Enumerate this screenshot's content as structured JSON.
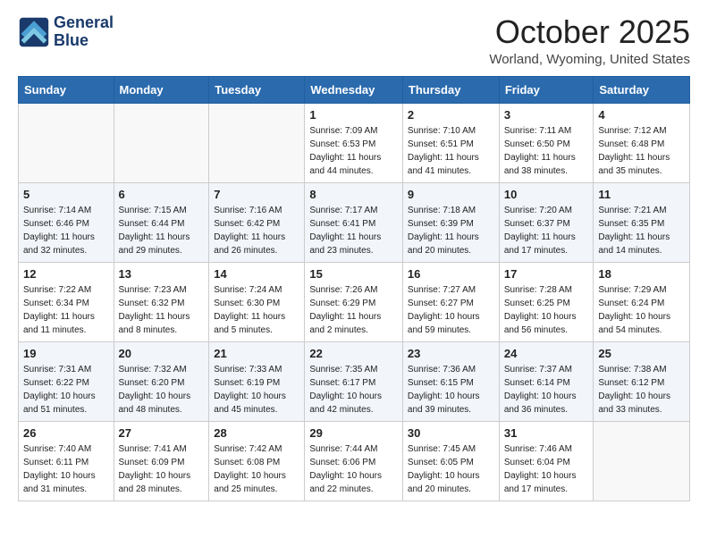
{
  "header": {
    "logo_line1": "General",
    "logo_line2": "Blue",
    "month_title": "October 2025",
    "location": "Worland, Wyoming, United States"
  },
  "days_of_week": [
    "Sunday",
    "Monday",
    "Tuesday",
    "Wednesday",
    "Thursday",
    "Friday",
    "Saturday"
  ],
  "weeks": [
    [
      {
        "day": "",
        "sunrise": "",
        "sunset": "",
        "daylight": ""
      },
      {
        "day": "",
        "sunrise": "",
        "sunset": "",
        "daylight": ""
      },
      {
        "day": "",
        "sunrise": "",
        "sunset": "",
        "daylight": ""
      },
      {
        "day": "1",
        "sunrise": "Sunrise: 7:09 AM",
        "sunset": "Sunset: 6:53 PM",
        "daylight": "Daylight: 11 hours and 44 minutes."
      },
      {
        "day": "2",
        "sunrise": "Sunrise: 7:10 AM",
        "sunset": "Sunset: 6:51 PM",
        "daylight": "Daylight: 11 hours and 41 minutes."
      },
      {
        "day": "3",
        "sunrise": "Sunrise: 7:11 AM",
        "sunset": "Sunset: 6:50 PM",
        "daylight": "Daylight: 11 hours and 38 minutes."
      },
      {
        "day": "4",
        "sunrise": "Sunrise: 7:12 AM",
        "sunset": "Sunset: 6:48 PM",
        "daylight": "Daylight: 11 hours and 35 minutes."
      }
    ],
    [
      {
        "day": "5",
        "sunrise": "Sunrise: 7:14 AM",
        "sunset": "Sunset: 6:46 PM",
        "daylight": "Daylight: 11 hours and 32 minutes."
      },
      {
        "day": "6",
        "sunrise": "Sunrise: 7:15 AM",
        "sunset": "Sunset: 6:44 PM",
        "daylight": "Daylight: 11 hours and 29 minutes."
      },
      {
        "day": "7",
        "sunrise": "Sunrise: 7:16 AM",
        "sunset": "Sunset: 6:42 PM",
        "daylight": "Daylight: 11 hours and 26 minutes."
      },
      {
        "day": "8",
        "sunrise": "Sunrise: 7:17 AM",
        "sunset": "Sunset: 6:41 PM",
        "daylight": "Daylight: 11 hours and 23 minutes."
      },
      {
        "day": "9",
        "sunrise": "Sunrise: 7:18 AM",
        "sunset": "Sunset: 6:39 PM",
        "daylight": "Daylight: 11 hours and 20 minutes."
      },
      {
        "day": "10",
        "sunrise": "Sunrise: 7:20 AM",
        "sunset": "Sunset: 6:37 PM",
        "daylight": "Daylight: 11 hours and 17 minutes."
      },
      {
        "day": "11",
        "sunrise": "Sunrise: 7:21 AM",
        "sunset": "Sunset: 6:35 PM",
        "daylight": "Daylight: 11 hours and 14 minutes."
      }
    ],
    [
      {
        "day": "12",
        "sunrise": "Sunrise: 7:22 AM",
        "sunset": "Sunset: 6:34 PM",
        "daylight": "Daylight: 11 hours and 11 minutes."
      },
      {
        "day": "13",
        "sunrise": "Sunrise: 7:23 AM",
        "sunset": "Sunset: 6:32 PM",
        "daylight": "Daylight: 11 hours and 8 minutes."
      },
      {
        "day": "14",
        "sunrise": "Sunrise: 7:24 AM",
        "sunset": "Sunset: 6:30 PM",
        "daylight": "Daylight: 11 hours and 5 minutes."
      },
      {
        "day": "15",
        "sunrise": "Sunrise: 7:26 AM",
        "sunset": "Sunset: 6:29 PM",
        "daylight": "Daylight: 11 hours and 2 minutes."
      },
      {
        "day": "16",
        "sunrise": "Sunrise: 7:27 AM",
        "sunset": "Sunset: 6:27 PM",
        "daylight": "Daylight: 10 hours and 59 minutes."
      },
      {
        "day": "17",
        "sunrise": "Sunrise: 7:28 AM",
        "sunset": "Sunset: 6:25 PM",
        "daylight": "Daylight: 10 hours and 56 minutes."
      },
      {
        "day": "18",
        "sunrise": "Sunrise: 7:29 AM",
        "sunset": "Sunset: 6:24 PM",
        "daylight": "Daylight: 10 hours and 54 minutes."
      }
    ],
    [
      {
        "day": "19",
        "sunrise": "Sunrise: 7:31 AM",
        "sunset": "Sunset: 6:22 PM",
        "daylight": "Daylight: 10 hours and 51 minutes."
      },
      {
        "day": "20",
        "sunrise": "Sunrise: 7:32 AM",
        "sunset": "Sunset: 6:20 PM",
        "daylight": "Daylight: 10 hours and 48 minutes."
      },
      {
        "day": "21",
        "sunrise": "Sunrise: 7:33 AM",
        "sunset": "Sunset: 6:19 PM",
        "daylight": "Daylight: 10 hours and 45 minutes."
      },
      {
        "day": "22",
        "sunrise": "Sunrise: 7:35 AM",
        "sunset": "Sunset: 6:17 PM",
        "daylight": "Daylight: 10 hours and 42 minutes."
      },
      {
        "day": "23",
        "sunrise": "Sunrise: 7:36 AM",
        "sunset": "Sunset: 6:15 PM",
        "daylight": "Daylight: 10 hours and 39 minutes."
      },
      {
        "day": "24",
        "sunrise": "Sunrise: 7:37 AM",
        "sunset": "Sunset: 6:14 PM",
        "daylight": "Daylight: 10 hours and 36 minutes."
      },
      {
        "day": "25",
        "sunrise": "Sunrise: 7:38 AM",
        "sunset": "Sunset: 6:12 PM",
        "daylight": "Daylight: 10 hours and 33 minutes."
      }
    ],
    [
      {
        "day": "26",
        "sunrise": "Sunrise: 7:40 AM",
        "sunset": "Sunset: 6:11 PM",
        "daylight": "Daylight: 10 hours and 31 minutes."
      },
      {
        "day": "27",
        "sunrise": "Sunrise: 7:41 AM",
        "sunset": "Sunset: 6:09 PM",
        "daylight": "Daylight: 10 hours and 28 minutes."
      },
      {
        "day": "28",
        "sunrise": "Sunrise: 7:42 AM",
        "sunset": "Sunset: 6:08 PM",
        "daylight": "Daylight: 10 hours and 25 minutes."
      },
      {
        "day": "29",
        "sunrise": "Sunrise: 7:44 AM",
        "sunset": "Sunset: 6:06 PM",
        "daylight": "Daylight: 10 hours and 22 minutes."
      },
      {
        "day": "30",
        "sunrise": "Sunrise: 7:45 AM",
        "sunset": "Sunset: 6:05 PM",
        "daylight": "Daylight: 10 hours and 20 minutes."
      },
      {
        "day": "31",
        "sunrise": "Sunrise: 7:46 AM",
        "sunset": "Sunset: 6:04 PM",
        "daylight": "Daylight: 10 hours and 17 minutes."
      },
      {
        "day": "",
        "sunrise": "",
        "sunset": "",
        "daylight": ""
      }
    ]
  ]
}
